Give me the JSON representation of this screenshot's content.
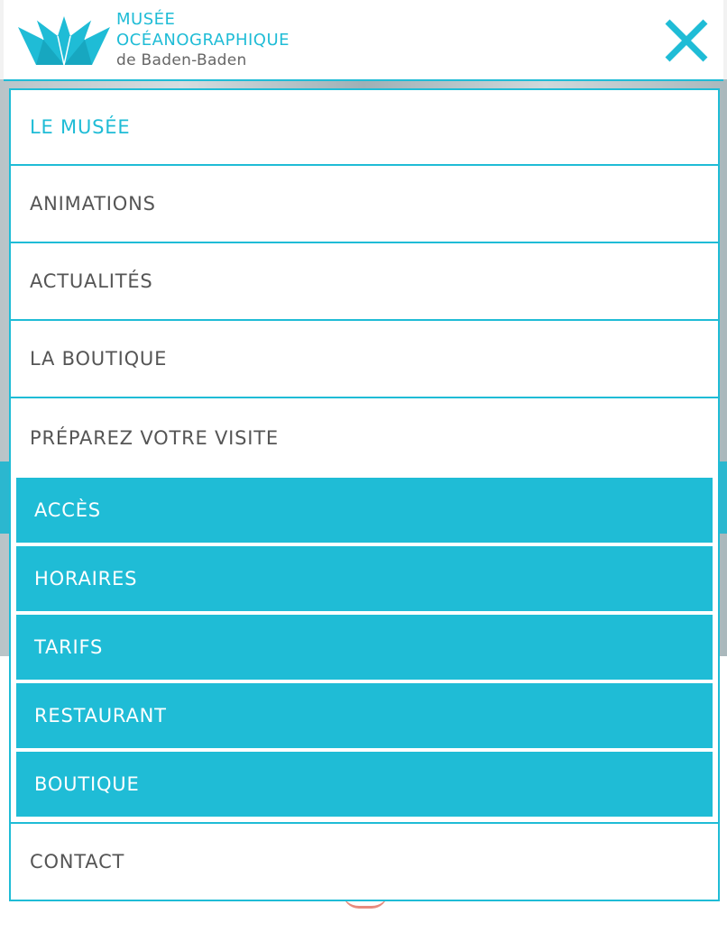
{
  "header": {
    "logo_line1": "MUSÉE",
    "logo_line2": "OCÉANOGRAPHIQUE",
    "logo_line3": "de Baden-Baden",
    "logo_icon": "paper-boat-icon",
    "close_icon": "close-icon"
  },
  "colors": {
    "accent": "#1fbcd6",
    "text": "#555555",
    "submenu_bg": "#1fbcd6",
    "submenu_text": "#ffffff"
  },
  "menu": {
    "items": [
      {
        "label": "LE MUSÉE"
      },
      {
        "label": "ANIMATIONS"
      },
      {
        "label": "ACTUALITÉS"
      },
      {
        "label": "LA BOUTIQUE"
      },
      {
        "label": "PRÉPAREZ VOTRE VISITE"
      }
    ],
    "submenu": [
      {
        "label": "ACCÈS"
      },
      {
        "label": "HORAIRES"
      },
      {
        "label": "TARIFS"
      },
      {
        "label": "RESTAURANT"
      },
      {
        "label": "BOUTIQUE"
      }
    ],
    "contact": {
      "label": "CONTACT"
    }
  }
}
